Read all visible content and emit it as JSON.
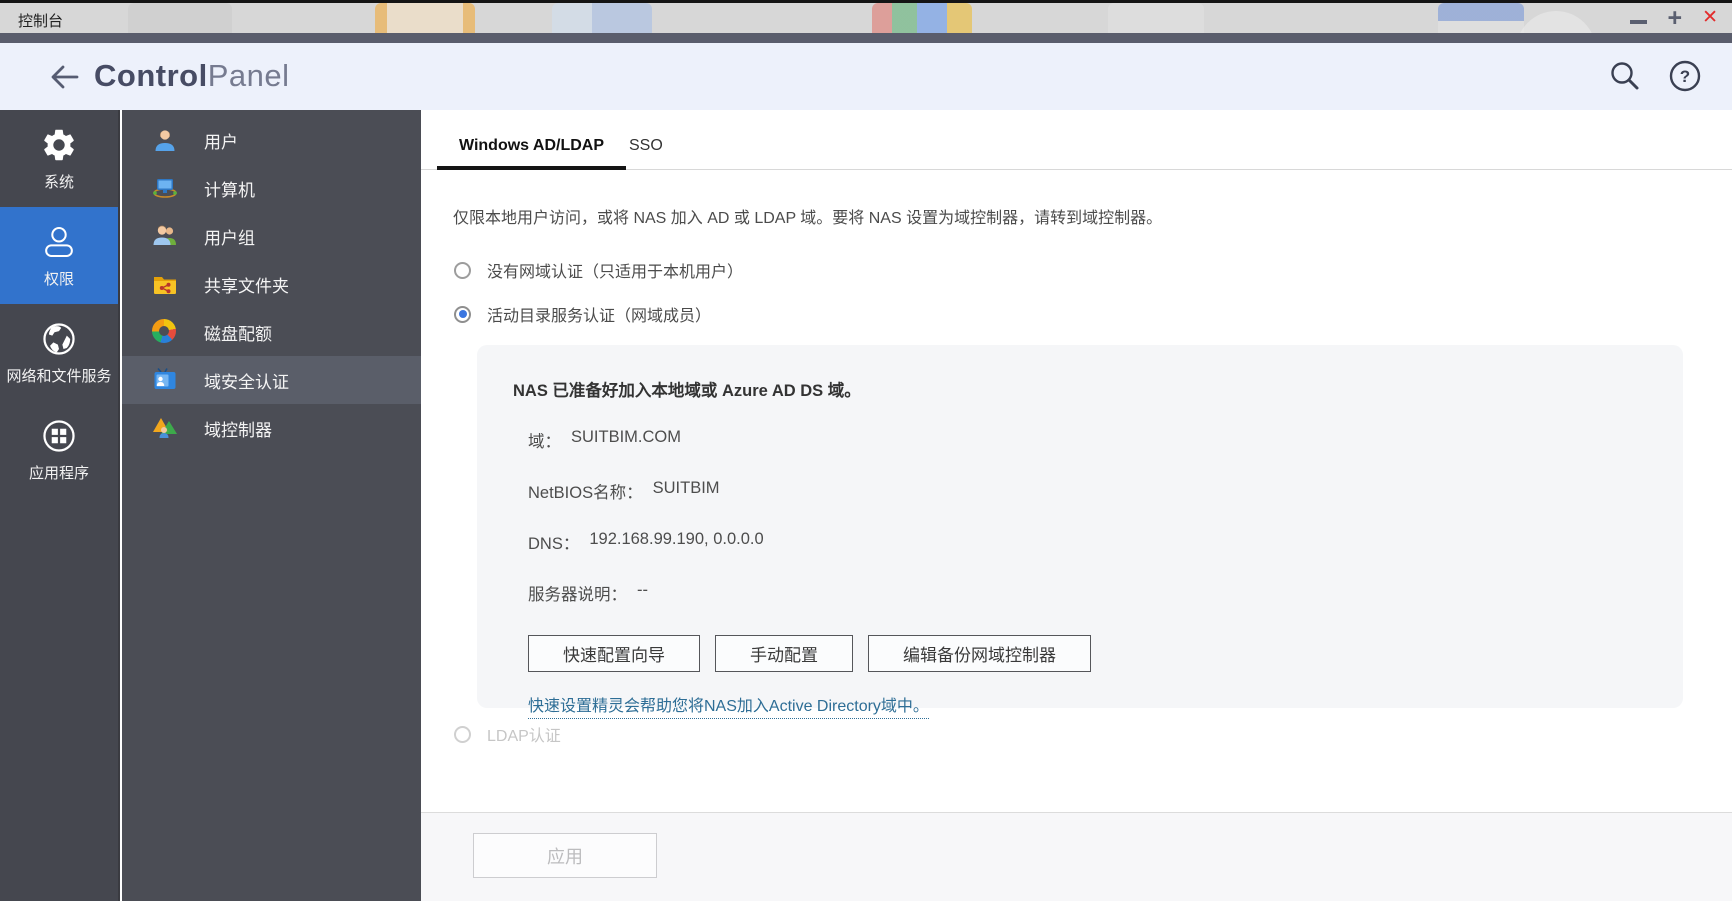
{
  "window": {
    "title": "控制台",
    "controls": {
      "minimize": "minimize",
      "maximize": "maximize",
      "close": "✕"
    }
  },
  "header": {
    "title_bold": "Control",
    "title_light": "Panel",
    "icons": [
      "back-arrow-icon",
      "search-icon",
      "help-icon"
    ]
  },
  "nav_sidebar": {
    "items": [
      {
        "label": "系统",
        "icon": "gear-icon",
        "selected": false
      },
      {
        "label": "权限",
        "icon": "user-outline-icon",
        "selected": true
      },
      {
        "label": "网络和文件服务",
        "icon": "globe-icon",
        "selected": false
      },
      {
        "label": "应用程序",
        "icon": "apps-circle-icon",
        "selected": false
      }
    ]
  },
  "menu_sidebar": {
    "items": [
      {
        "label": "用户",
        "icon": "user-icon",
        "selected": false
      },
      {
        "label": "计算机",
        "icon": "computer-icon",
        "selected": false
      },
      {
        "label": "用户组",
        "icon": "user-group-icon",
        "selected": false
      },
      {
        "label": "共享文件夹",
        "icon": "shared-folder-icon",
        "selected": false
      },
      {
        "label": "磁盘配额",
        "icon": "quota-donut-icon",
        "selected": false
      },
      {
        "label": "域安全认证",
        "icon": "domain-security-icon",
        "selected": true
      },
      {
        "label": "域控制器",
        "icon": "domain-controller-icon",
        "selected": false
      }
    ]
  },
  "content": {
    "tabs": [
      {
        "label": "Windows AD/LDAP",
        "active": true
      },
      {
        "label": "SSO",
        "active": false
      }
    ],
    "description": "仅限本地用户访问，或将 NAS 加入 AD 或 LDAP 域。要将 NAS 设置为域控制器，请转到域控制器。",
    "radios": [
      {
        "label": "没有网域认证（只适用于本机用户）",
        "checked": false,
        "disabled": false
      },
      {
        "label": "活动目录服务认证（网域成员）",
        "checked": true,
        "disabled": false
      },
      {
        "label": "LDAP认证",
        "checked": false,
        "disabled": true
      }
    ],
    "ad_panel": {
      "status": "NAS 已准备好加入本地域或 Azure AD DS 域。",
      "fields": [
        {
          "label": "域：",
          "value": "SUITBIM.COM"
        },
        {
          "label": "NetBIOS名称：",
          "value": "SUITBIM"
        },
        {
          "label": "DNS：",
          "value": "192.168.99.190, 0.0.0.0"
        },
        {
          "label": "服务器说明：",
          "value": "--"
        }
      ],
      "buttons": [
        "快速配置向导",
        "手动配置",
        "编辑备份网域控制器"
      ],
      "hint": "快速设置精灵会帮助您将NAS加入Active Directory域中。"
    },
    "footer": {
      "apply_label": "应用"
    }
  },
  "colors": {
    "accent_blue": "#3273cc",
    "radio_blue": "#3b76e0",
    "link_blue": "#2e6e96",
    "close_red": "#e22b2b",
    "sidebar_dark": "#45474f",
    "panel_gray": "#f5f6f8",
    "header_bg": "#edf1fb"
  }
}
